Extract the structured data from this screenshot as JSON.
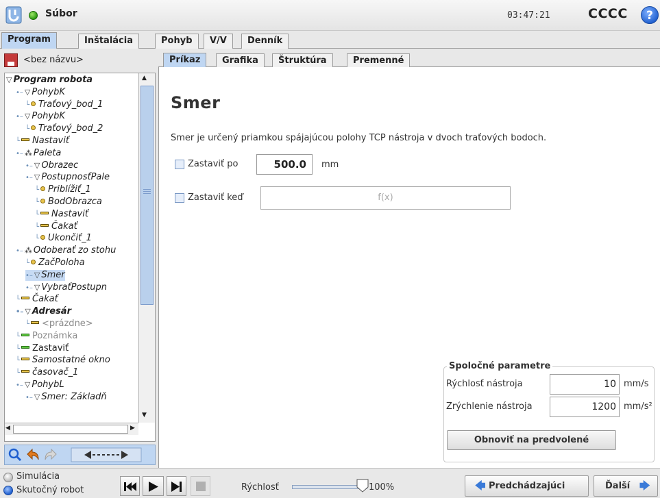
{
  "header": {
    "file_menu": "Súbor",
    "clock": "03:47:21",
    "robot_name": "CCCC",
    "help": "?"
  },
  "main_tabs": [
    {
      "label": "Program",
      "active": true
    },
    {
      "label": "Inštalácia",
      "active": false
    },
    {
      "label": "Pohyb",
      "active": false
    },
    {
      "label": "V/V",
      "active": false
    },
    {
      "label": "Denník",
      "active": false
    }
  ],
  "left_panel": {
    "program_name": "<bez názvu>",
    "tree": [
      {
        "label": "Program robota",
        "icon": "triangle",
        "depth": 0,
        "style": "bold"
      },
      {
        "label": "PohybK",
        "icon": "triangle",
        "depth": 1
      },
      {
        "label": "Traťový_bod_1",
        "icon": "dot",
        "depth": 2
      },
      {
        "label": "PohybK",
        "icon": "triangle",
        "depth": 1
      },
      {
        "label": "Traťový_bod_2",
        "icon": "dot",
        "depth": 2
      },
      {
        "label": "Nastaviť",
        "icon": "bar",
        "depth": 1
      },
      {
        "label": "Paleta",
        "icon": "pallet",
        "depth": 1
      },
      {
        "label": "Obrazec",
        "icon": "triangle",
        "depth": 2
      },
      {
        "label": "PostupnosťPale",
        "icon": "triangle",
        "depth": 2
      },
      {
        "label": "Priblížiť_1",
        "icon": "dot",
        "depth": 3
      },
      {
        "label": "BodObrazca",
        "icon": "dot",
        "depth": 3
      },
      {
        "label": "Nastaviť",
        "icon": "bar",
        "depth": 3
      },
      {
        "label": "Čakať",
        "icon": "bar",
        "depth": 3
      },
      {
        "label": "Ukončiť_1",
        "icon": "dot",
        "depth": 3
      },
      {
        "label": "Odoberať zo stohu",
        "icon": "pallet",
        "depth": 1
      },
      {
        "label": "ZačPoloha",
        "icon": "dot",
        "depth": 2
      },
      {
        "label": "Smer",
        "icon": "triangle",
        "depth": 2,
        "selected": true
      },
      {
        "label": "VybraťPostupn",
        "icon": "triangle",
        "depth": 2
      },
      {
        "label": "Čakať",
        "icon": "bar",
        "depth": 1
      },
      {
        "label": "Adresár",
        "icon": "triangle",
        "depth": 1,
        "style": "bold"
      },
      {
        "label": "<prázdne>",
        "icon": "bar",
        "depth": 2,
        "style": "grey"
      },
      {
        "label": "Poznámka",
        "icon": "bar-green",
        "depth": 1,
        "style": "grey"
      },
      {
        "label": "Zastaviť",
        "icon": "bar-green",
        "depth": 1,
        "style": "normal"
      },
      {
        "label": "Samostatné okno",
        "icon": "bar",
        "depth": 1
      },
      {
        "label": "časovač_1",
        "icon": "bar",
        "depth": 1
      },
      {
        "label": "PohybL",
        "icon": "triangle",
        "depth": 1
      },
      {
        "label": "Smer: Základň",
        "icon": "triangle",
        "depth": 2
      }
    ]
  },
  "sub_tabs": [
    {
      "label": "Príkaz",
      "active": true
    },
    {
      "label": "Grafika",
      "active": false
    },
    {
      "label": "Štruktúra",
      "active": false
    },
    {
      "label": "Premenné",
      "active": false
    }
  ],
  "command": {
    "title": "Smer",
    "description": "Smer je určený priamkou spájajúcou polohy TCP nástroja v dvoch traťových bodoch.",
    "stop_after_label": "Zastaviť po",
    "stop_after_checked": false,
    "stop_after_value": "500.0",
    "stop_after_unit": "mm",
    "stop_when_label": "Zastaviť keď",
    "stop_when_checked": false,
    "stop_when_placeholder": "f(x)"
  },
  "shared_params": {
    "title": "Spoločné parametre",
    "tool_speed_label": "Rýchlosť nástroja",
    "tool_speed_value": "10",
    "tool_speed_unit": "mm/s",
    "tool_accel_label": "Zrýchlenie nástroja",
    "tool_accel_value": "1200",
    "tool_accel_unit": "mm/s²",
    "reset_label": "Obnoviť na predvolené"
  },
  "bottom": {
    "simulation_label": "Simulácia",
    "real_robot_label": "Skutočný robot",
    "selected_mode": "Skutočný robot",
    "speed_label": "Rýchlosť",
    "speed_value": "100%",
    "speed_fraction": 1.0,
    "prev_label": "Predchádzajúci",
    "next_label": "Ďalší"
  }
}
